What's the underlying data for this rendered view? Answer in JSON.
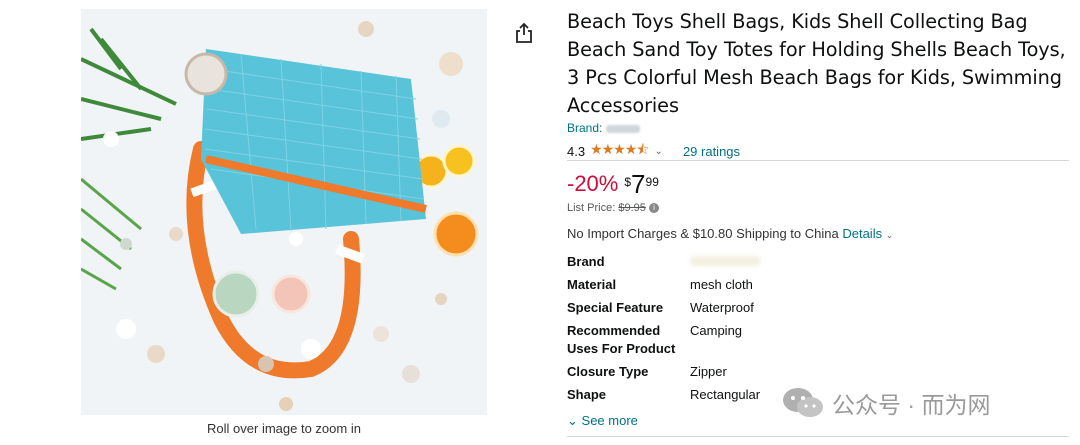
{
  "product": {
    "title": "Beach Toys Shell Bags, Kids Shell Collecting Bag Beach Sand Toy Totes for Holding Shells Beach Toys, 3 Pcs Colorful Mesh Beach Bags for Kids, Swimming Accessories",
    "brand_label": "Brand:",
    "rating_value": "4.3",
    "rating_stars": 4.3,
    "ratings_count": "29 ratings"
  },
  "pricing": {
    "discount": "-20%",
    "currency_symbol": "$",
    "price_whole": "7",
    "price_fraction": "99",
    "list_price_label": "List Price:",
    "list_price": "$9.95"
  },
  "shipping": {
    "text": "No Import Charges & $10.80 Shipping to China",
    "details_label": "Details"
  },
  "specs": [
    {
      "key": "Brand",
      "value": ""
    },
    {
      "key": "Material",
      "value": "mesh cloth"
    },
    {
      "key": "Special Feature",
      "value": "Waterproof"
    },
    {
      "key": "Recommended Uses For Product",
      "value": "Camping"
    },
    {
      "key": "Closure Type",
      "value": "Zipper"
    },
    {
      "key": "Shape",
      "value": "Rectangular"
    }
  ],
  "see_more_label": "See more",
  "image": {
    "zoom_hint": "Roll over image to zoom in"
  },
  "icons": {
    "share": "share-icon",
    "chevron": "chevron-down-icon",
    "info": "info-icon"
  },
  "colors": {
    "link": "#007185",
    "discount": "#cc0c39",
    "star": "#de7921",
    "bag_mesh": "#59c3d9",
    "strap": "#f07a2b"
  },
  "watermark": {
    "text": "公众号 · 而为网"
  }
}
